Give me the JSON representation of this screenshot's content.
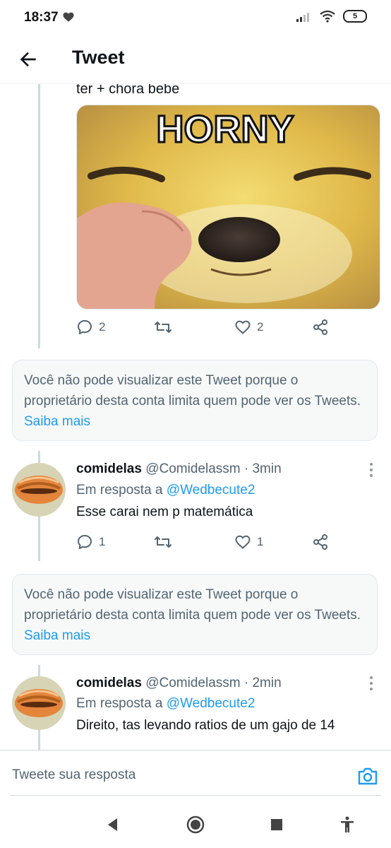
{
  "status_bar": {
    "time": "18:37",
    "battery": "5"
  },
  "header": {
    "title": "Tweet"
  },
  "tweet_top": {
    "text": "ter + chora bebe",
    "media_caption": "HORNY",
    "replies": "2",
    "likes": "2"
  },
  "notice_1": {
    "text": "Você não pode visualizar este Tweet porque o proprietário desta conta limita quem pode ver os Tweets.",
    "link": "Saiba mais"
  },
  "reply_1": {
    "name": "comidelas",
    "handle": "@Comidelassm",
    "time": "3min",
    "in_reply_prefix": "Em resposta a",
    "in_reply_handle": "@Wedbecute2",
    "text": "Esse carai nem p matemática",
    "replies": "1",
    "likes": "1"
  },
  "notice_2": {
    "text": "Você não pode visualizar este Tweet porque o proprietário desta conta limita quem pode ver os Tweets.",
    "link": "Saiba mais"
  },
  "reply_2": {
    "name": "comidelas",
    "handle": "@Comidelassm",
    "time": "2min",
    "in_reply_prefix": "Em resposta a",
    "in_reply_handle": "@Wedbecute2",
    "text": "Direito, tas levando ratios de um gajo de 14"
  },
  "composer": {
    "placeholder": "Tweete sua resposta"
  },
  "colors": {
    "accent": "#1d9bf0",
    "secondary_text": "#536471",
    "text": "#0f1419",
    "notice_bg": "#f7f9f9"
  },
  "icons": [
    "heart-icon",
    "signal-icon",
    "wifi-icon",
    "battery-icon",
    "back-arrow-icon",
    "reply-icon",
    "retweet-icon",
    "like-icon",
    "share-icon",
    "more-icon",
    "camera-icon",
    "nav-back-icon",
    "nav-home-icon",
    "nav-recents-icon",
    "accessibility-icon"
  ]
}
